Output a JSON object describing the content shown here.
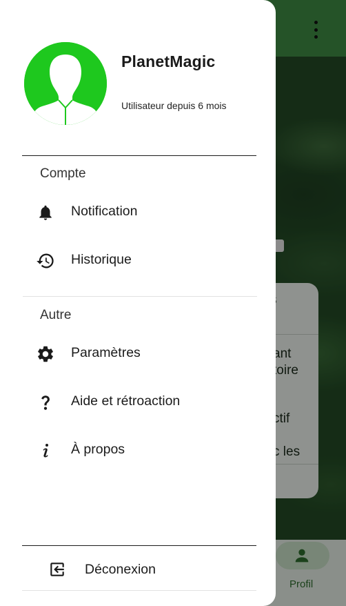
{
  "colors": {
    "app_bar": "#3f8b43",
    "avatar": "#1ec81e",
    "drawer_bg": "#ffffff",
    "accent_green": "#2e6d2e"
  },
  "background": {
    "fragments": [
      "s",
      "ant",
      "toire",
      "ctif",
      "c les"
    ],
    "bottom_nav": {
      "profile_label": "Profil",
      "profile_icon": "person-icon"
    }
  },
  "user": {
    "name": "PlanetMagic",
    "since": "Utilisateur depuis 6 mois"
  },
  "sections": {
    "account_title": "Compte",
    "other_title": "Autre"
  },
  "menu": {
    "notification": {
      "label": "Notification",
      "icon": "bell-icon"
    },
    "history": {
      "label": "Historique",
      "icon": "history-icon"
    },
    "settings": {
      "label": "Paramètres",
      "icon": "gear-icon"
    },
    "help": {
      "label": "Aide et rétroaction",
      "icon": "question-icon"
    },
    "about": {
      "label": "À propos",
      "icon": "info-icon"
    }
  },
  "logout": {
    "label": "Déconexion",
    "icon": "logout-icon"
  }
}
